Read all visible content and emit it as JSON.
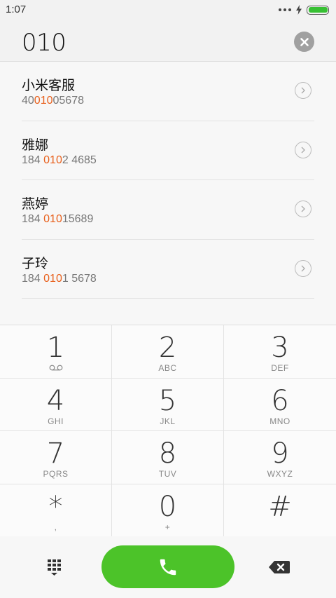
{
  "status_bar": {
    "time": "1:07",
    "battery_color": "#37c033"
  },
  "search": {
    "query": "010",
    "clear_icon": "clear-circle-icon"
  },
  "results": [
    {
      "name": "小米客服",
      "number_before": "40",
      "number_match": "010",
      "number_after": "05678"
    },
    {
      "name": "雅娜",
      "number_before": "184 ",
      "number_match": "010",
      "number_after": "2 4685"
    },
    {
      "name": "燕婷",
      "number_before": "184 ",
      "number_match": "010",
      "number_after": "15689"
    },
    {
      "name": "子玲",
      "number_before": "184 ",
      "number_match": "010",
      "number_after": "1 5678"
    }
  ],
  "highlight_color": "#e8601c",
  "keypad": {
    "keys": [
      {
        "digit": "1",
        "letters": "",
        "icon": "voicemail-icon"
      },
      {
        "digit": "2",
        "letters": "ABC"
      },
      {
        "digit": "3",
        "letters": "DEF"
      },
      {
        "digit": "4",
        "letters": "GHI"
      },
      {
        "digit": "5",
        "letters": "JKL"
      },
      {
        "digit": "6",
        "letters": "MNO"
      },
      {
        "digit": "7",
        "letters": "PQRS"
      },
      {
        "digit": "8",
        "letters": "TUV"
      },
      {
        "digit": "9",
        "letters": "WXYZ"
      },
      {
        "digit": "*",
        "letters": ","
      },
      {
        "digit": "0",
        "letters": "+"
      },
      {
        "digit": "#",
        "letters": ""
      }
    ]
  },
  "bottom_bar": {
    "keypad_toggle_icon": "dialpad-grid-icon",
    "call_icon": "phone-icon",
    "call_color": "#4cc329",
    "backspace_icon": "backspace-icon"
  }
}
